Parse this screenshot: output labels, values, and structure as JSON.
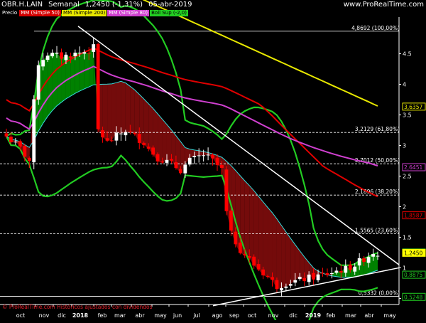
{
  "header": {
    "symbol": "OBR.H.LAIN",
    "period": "Semanal",
    "quote": "1,2450 (-1,31%)",
    "date": "05-abr-2019",
    "source_url": "www.ProRealTime.com"
  },
  "legend": [
    {
      "label": "Precio",
      "bg": "#000000",
      "fg": "#ffffff"
    },
    {
      "label": "MM (Simple 50)",
      "bg": "#d40000",
      "fg": "#ffffff"
    },
    {
      "label": "MM (Simple 200)",
      "bg": "#e8e800",
      "fg": "#000000"
    },
    {
      "label": "MM (Simple 80)",
      "bg": "#d040d0",
      "fg": "#ffffff"
    },
    {
      "label": "Boll Sup (-2,0)",
      "bg": "#22cc22",
      "fg": "#000000"
    }
  ],
  "footer": {
    "note": "© ProRealTime.com   Históricos ajustados con dividendos"
  },
  "colors": {
    "background": "#000000",
    "axis": "#ffffff",
    "candle_up": "#ffffff",
    "candle_down": "#ff0000",
    "sma50": "#e00000",
    "sma200": "#e8e800",
    "sma80": "#d040d0",
    "bollinger": "#22cc22",
    "fill_up": "#008800",
    "fill_down": "#7a0c0c",
    "trendline": "#ffffff"
  },
  "chart_data": {
    "type": "candlestick",
    "ylim": [
      0.4,
      5.1
    ],
    "x_tick_labels": [
      "oct",
      "nov",
      "dic",
      "2018",
      "feb",
      "mar",
      "abr",
      "may",
      "jun",
      "jul",
      "ago",
      "sep",
      "oct",
      "nov",
      "dic",
      "2019",
      "feb",
      "mar",
      "abr",
      "may"
    ],
    "y_tick_labels": [
      "0.5",
      "1",
      "1.5",
      "2",
      "2.5",
      "3",
      "3.5",
      "4",
      "4.5"
    ],
    "y_ticks": [
      0.5,
      1,
      1.5,
      2,
      2.5,
      3,
      3.5,
      4,
      4.5
    ],
    "fibonacci_levels": [
      {
        "value": 4.8692,
        "label": "4,8692 (100,00%)"
      },
      {
        "value": 3.2129,
        "label": "3,2129 (61,80%)"
      },
      {
        "value": 2.7012,
        "label": "2,7012 (50,00%)"
      },
      {
        "value": 2.1896,
        "label": "2,1896 (38,20%)"
      },
      {
        "value": 1.5565,
        "label": "1,5565 (23,60%)"
      },
      {
        "value": 0.5332,
        "label": "0,5332 (0,00%)"
      }
    ],
    "price_tags": [
      {
        "value": 3.6357,
        "label": "3,6357",
        "series": "sma200"
      },
      {
        "value": 2.6451,
        "label": "2,6451",
        "series": "sma80"
      },
      {
        "value": 1.8587,
        "label": "1,8587",
        "series": "sma50"
      },
      {
        "value": 1.2502,
        "label": "1,2502",
        "series": "bb_upper"
      },
      {
        "value": 1.245,
        "label": "1,2450",
        "series": "price"
      },
      {
        "value": 0.8875,
        "label": "0,8875",
        "series": "bb_mid"
      },
      {
        "value": 0.5248,
        "label": "0,5248",
        "series": "bb_lower"
      }
    ],
    "grid": false,
    "legend_position": "top-left"
  }
}
